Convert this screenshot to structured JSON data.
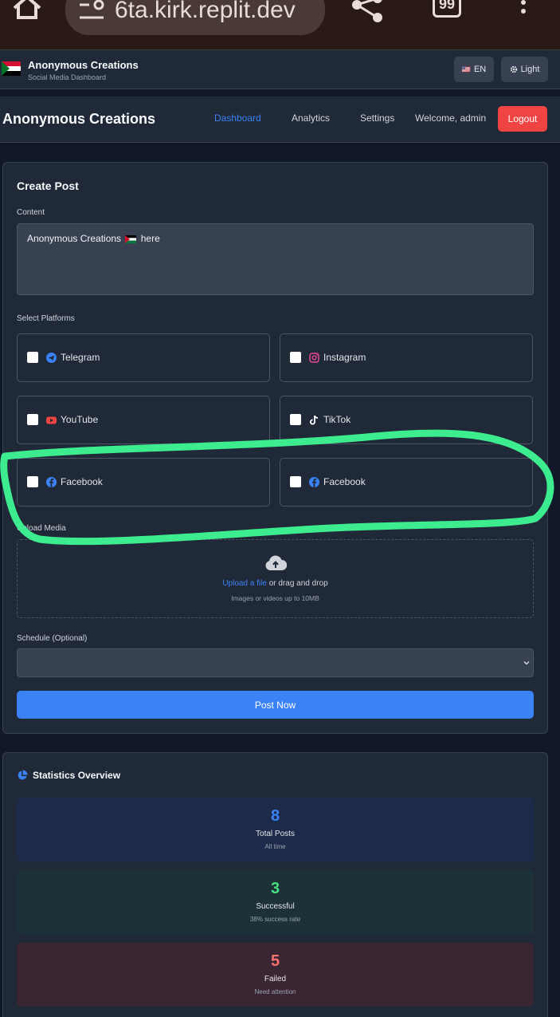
{
  "browser": {
    "url": "6ta.kirk.replit.dev",
    "tab_count": "99",
    "icons": [
      "home-icon",
      "tune-icon",
      "share-icon",
      "tabs-icon",
      "more-vert-icon"
    ]
  },
  "topbar": {
    "title": "Anonymous Creations",
    "subtitle": "Social Media Dashboard",
    "lang_flag": "🇺🇸",
    "lang_label": "EN",
    "theme_label": "Light"
  },
  "nav": {
    "title": "Anonymous Creations",
    "links": [
      "Dashboard",
      "Analytics",
      "Settings"
    ],
    "active": "Dashboard",
    "welcome": "Welcome, admin",
    "logout": "Logout"
  },
  "create_post": {
    "title": "Create Post",
    "content_label": "Content",
    "content_before": "Anonymous Creations",
    "content_after": "here",
    "platforms_label": "Select Platforms",
    "platforms": [
      {
        "label": "Telegram",
        "icon": "telegram-icon",
        "color": "#3b82f6"
      },
      {
        "label": "Instagram",
        "icon": "instagram-icon",
        "color": "#ec4899"
      },
      {
        "label": "YouTube",
        "icon": "youtube-icon",
        "color": "#ef4444"
      },
      {
        "label": "TikTok",
        "icon": "tiktok-icon",
        "color": "#ffffff"
      },
      {
        "label": "Facebook",
        "icon": "facebook-icon",
        "color": "#3b82f6"
      },
      {
        "label": "Facebook",
        "icon": "facebook-icon",
        "color": "#3b82f6"
      }
    ],
    "upload_label": "Upload Media",
    "upload_link": "Upload a file",
    "upload_text": "or drag and drop",
    "upload_hint": "Images or videos up to 10MB",
    "schedule_label": "Schedule (Optional)",
    "schedule_value": "",
    "post_button": "Post Now"
  },
  "stats": {
    "title": "Statistics Overview",
    "items": [
      {
        "value": "8",
        "label": "Total Posts",
        "sub": "All time",
        "color": "#3b82f6",
        "bg": "#1e2a4a"
      },
      {
        "value": "3",
        "label": "Successful",
        "sub": "38% success rate",
        "color": "#4ade80",
        "bg": "#1c3238"
      },
      {
        "value": "5",
        "label": "Failed",
        "sub": "Need attention",
        "color": "#f87171",
        "bg": "#3a2532"
      }
    ]
  },
  "colors": {
    "accent": "#3b82f6",
    "danger": "#ef4444",
    "highlight": "#3dec8f"
  }
}
